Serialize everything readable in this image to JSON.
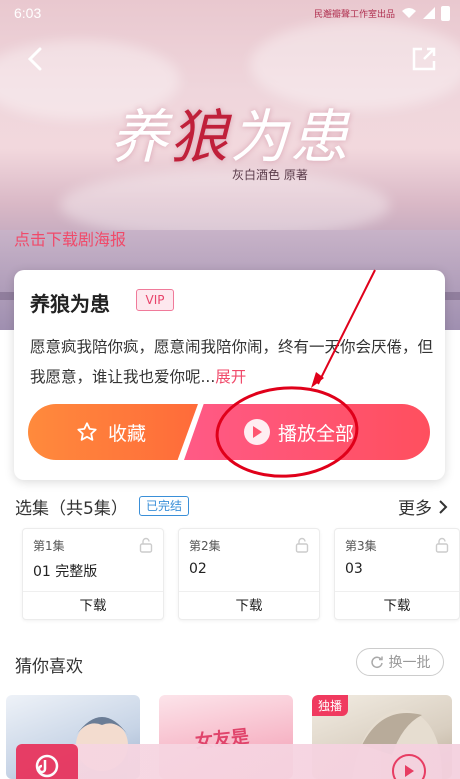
{
  "status_bar": {
    "time": "6:03",
    "studio": "民邂瓣聲工作室出品"
  },
  "hero": {
    "title_art_1": "养",
    "title_art_2": "狼",
    "title_art_3": "为患",
    "author_art": "灰白酒色 原著",
    "poster_download": "点击下载剧海报"
  },
  "drama": {
    "title": "养狼为患",
    "vip_badge": "VIP",
    "description": "愿意疯我陪你疯，愿意闹我陪你闹，终有一天你会厌倦，但我愿意，谁让我也爱你呢...",
    "expand": "展开",
    "favorite_label": "收藏",
    "play_all_label": "播放全部"
  },
  "episodes": {
    "section_title": "选集（共5集）",
    "status_badge": "已完结",
    "more_label": "更多",
    "items": [
      {
        "num": "第1集",
        "name": "01 完整版",
        "download": "下载"
      },
      {
        "num": "第2集",
        "name": "02",
        "download": "下载"
      },
      {
        "num": "第3集",
        "name": "03",
        "download": "下载"
      }
    ]
  },
  "recommend": {
    "section_title": "猜你喜欢",
    "refresh_label": "换一批",
    "cover2_text": "女友是",
    "exclusive_badge": "独播"
  },
  "colors": {
    "accent_pink": "#f04a6a",
    "orange": "#ff7b3a",
    "blue_badge": "#3a8fd8",
    "annotation_red": "#e0001a"
  }
}
